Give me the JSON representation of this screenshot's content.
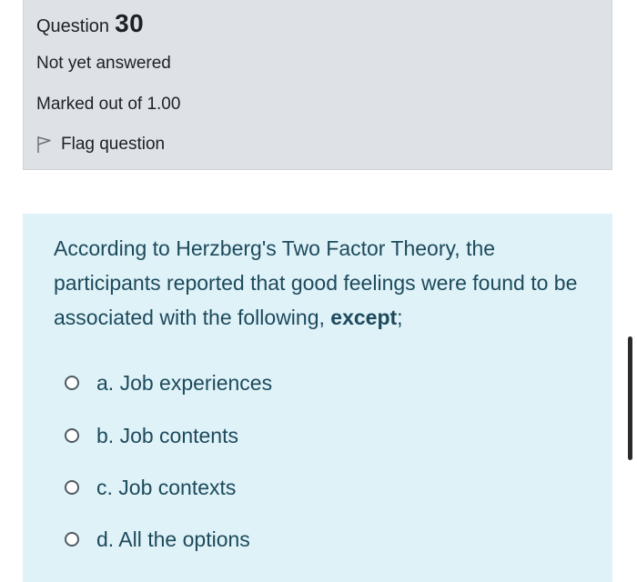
{
  "question": {
    "label": "Question",
    "number": "30",
    "state": "Not yet answered",
    "grade": "Marked out of 1.00",
    "flag_label": "Flag question"
  },
  "prompt": {
    "text_before": "According to Herzberg's Two Factor Theory, the participants reported that good feelings were found to be associated with the following, ",
    "emphasis": "except",
    "text_after": ";"
  },
  "answers": [
    {
      "label": "a. Job experiences",
      "selected": false
    },
    {
      "label": "b. Job contents",
      "selected": false
    },
    {
      "label": "c. Job contexts",
      "selected": false
    },
    {
      "label": "d. All the options",
      "selected": false
    }
  ],
  "colors": {
    "info_bg": "#dee2e6",
    "content_bg": "#def2f8",
    "text_dark": "#1d2125",
    "text_content": "#1d4a5c"
  },
  "icons": {
    "flag": "flag-outline-icon",
    "radio": "radio-unchecked-icon"
  }
}
